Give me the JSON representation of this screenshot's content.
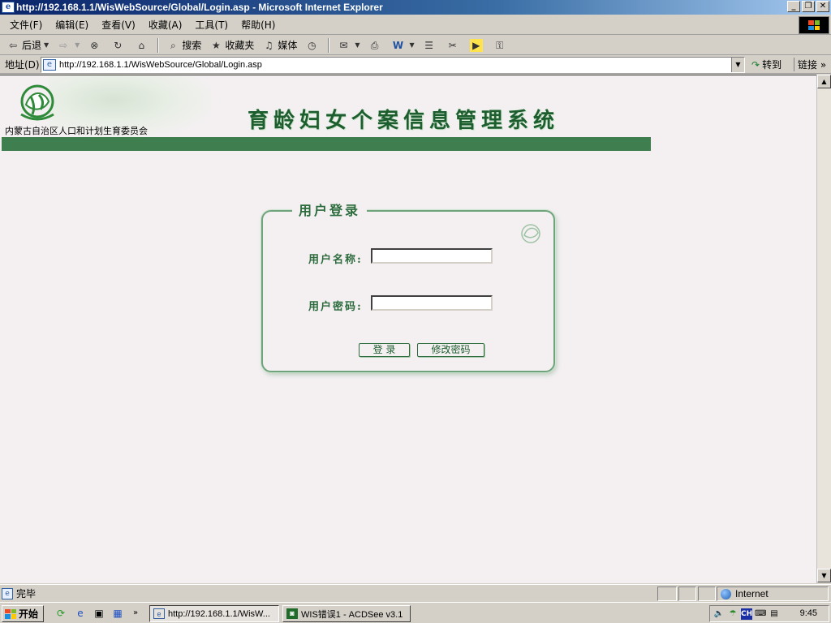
{
  "window": {
    "title": "http://192.168.1.1/WisWebSource/Global/Login.asp - Microsoft Internet Explorer",
    "minimize": "_",
    "restore": "❐",
    "close": "✕"
  },
  "menu": {
    "items": [
      "文件(F)",
      "编辑(E)",
      "查看(V)",
      "收藏(A)",
      "工具(T)",
      "帮助(H)"
    ]
  },
  "toolbar": {
    "back": "后退",
    "search": "搜索",
    "favorites": "收藏夹",
    "media": "媒体"
  },
  "address": {
    "label": "地址(D)",
    "url": "http://192.168.1.1/WisWebSource/Global/Login.asp",
    "go": "转到",
    "links": "链接"
  },
  "page": {
    "org_name": "内蒙古自治区人口和计划生育委员会",
    "system_title": "育龄妇女个案信息管理系统",
    "login_title": "用户登录",
    "username_label": "用户名称:",
    "password_label": "用户密码:",
    "username_value": "",
    "password_value": "",
    "login_button": "登 录",
    "change_password_button": "修改密码"
  },
  "status": {
    "text": "完毕",
    "zone": "Internet"
  },
  "taskbar": {
    "start": "开始",
    "tasks": [
      "http://192.168.1.1/WisW...",
      "WIS错误1 - ACDSee v3.1"
    ],
    "ime": "CH",
    "clock": "9:45"
  },
  "colors": {
    "brand_green": "#3f7f4f",
    "title_green": "#1d5e2e",
    "page_bg": "#f4f0f2"
  }
}
